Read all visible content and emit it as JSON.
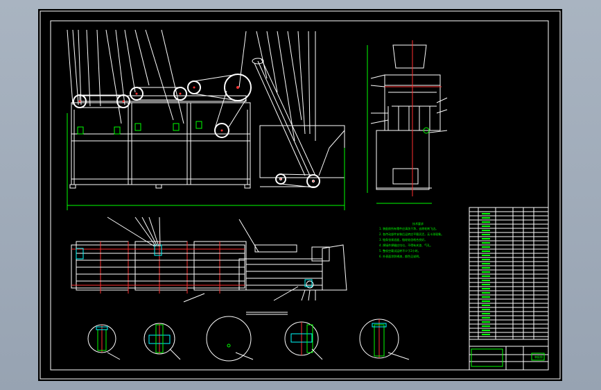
{
  "drawing": {
    "background_color": "#000000",
    "frame_color": "#ffffff",
    "dimension_color": "#00ff00",
    "centerline_color": "#ff3030",
    "section_color": "#00ffff",
    "notes_title": "技术要求",
    "notes_lines": [
      "1. 装配前所有零件应清洗干净，去除毛刺飞边。",
      "2. 各传动部件安装后运转应平稳灵活，无卡滞现象。",
      "3. 链条张紧适度，链轮轮齿啮合良好。",
      "4. 焊接件焊缝应均匀，不得有夹渣、气孔。",
      "5. 整机空载试运转不少于2小时。",
      "6. 外表面涂防锈漆，颜色见说明。"
    ],
    "title_block_label": "装配图"
  }
}
